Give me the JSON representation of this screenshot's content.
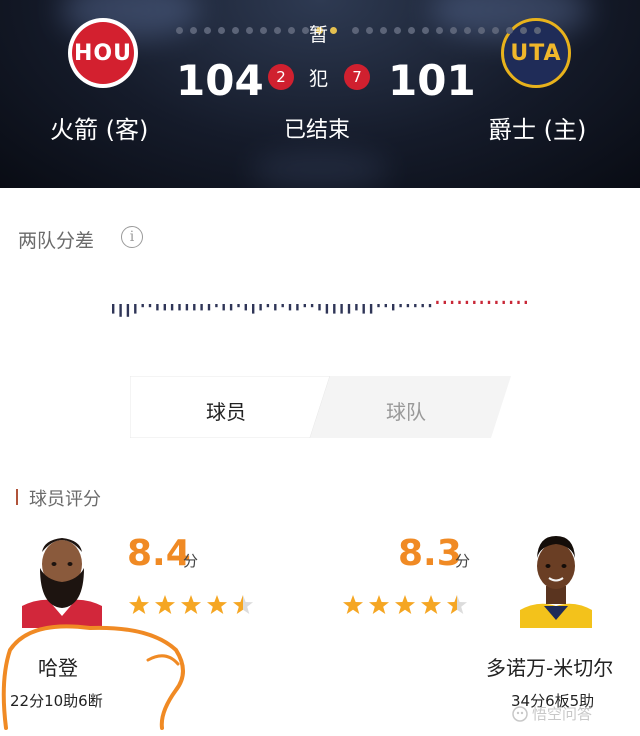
{
  "header": {
    "away_team": {
      "abbr": "HOU",
      "name": "火箭 (客)",
      "score": "104",
      "fouls": "2",
      "color": "#d3202f"
    },
    "home_team": {
      "abbr": "UTA",
      "name": "爵士 (主)",
      "score": "101",
      "fouls": "7",
      "color": "#1f2c58"
    },
    "pause_label": "暂",
    "foul_label": "犯",
    "status": "已结束"
  },
  "gap_section": {
    "title": "两队分差",
    "info_icon": "info-icon",
    "chart_data": {
      "type": "bar",
      "values": [
        -3,
        -4,
        -4,
        -3,
        -1,
        -1,
        -2,
        -2,
        -2,
        -2,
        -2,
        -2,
        -2,
        -2,
        -1,
        -2,
        -2,
        -1,
        -2,
        -3,
        -2,
        -1,
        -2,
        -1,
        -2,
        -2,
        -1,
        -1,
        -2,
        -3,
        -3,
        -3,
        -3,
        -2,
        -3,
        -3,
        -1,
        -1,
        -2,
        -1,
        -1,
        -1,
        -1,
        -1,
        1,
        1,
        1,
        1,
        1,
        1,
        1,
        1,
        1,
        1,
        1,
        1,
        1
      ],
      "colors": {
        "home_lead": "#2f3557",
        "away_lead": "#c82737"
      }
    }
  },
  "tabs": {
    "players": "球员",
    "team": "球队",
    "active": "players"
  },
  "ratings": {
    "title": "球员评分",
    "unit": "分",
    "left_player": {
      "name": "哈登",
      "score": "8.4",
      "stars": 4.5,
      "stats": "22分10助6断"
    },
    "right_player": {
      "name": "多诺万-米切尔",
      "score": "8.3",
      "stars": 4.5,
      "stats": "34分6板5助"
    }
  },
  "watermark": {
    "text": "悟空问答"
  },
  "colors": {
    "accent": "#f08a24",
    "star": "#f5a623",
    "star_empty": "#dcdcdc"
  }
}
